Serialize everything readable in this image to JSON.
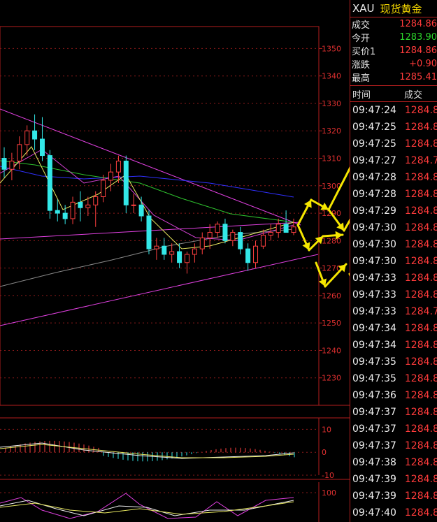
{
  "quote": {
    "symbol": "XAU",
    "name": "现货黄金",
    "rows": [
      {
        "label": "成交",
        "value": "1284.86",
        "color": "#ff3b3b"
      },
      {
        "label": "今开",
        "value": "1283.90",
        "color": "#2bd52b"
      },
      {
        "label": "买价1",
        "value": "1284.86",
        "color": "#ff3b3b"
      },
      {
        "label": "涨跌",
        "value": "+0.90",
        "color": "#ff3b3b"
      },
      {
        "label": "最高",
        "value": "1285.41",
        "color": "#ff3b3b"
      }
    ]
  },
  "ticks": {
    "headers": [
      "时间",
      "成交"
    ],
    "rows": [
      {
        "time": "09:47:24",
        "price": "1284.8"
      },
      {
        "time": "09:47:25",
        "price": "1284.8"
      },
      {
        "time": "09:47:25",
        "price": "1284.8"
      },
      {
        "time": "09:47:27",
        "price": "1284.7"
      },
      {
        "time": "09:47:28",
        "price": "1284.8"
      },
      {
        "time": "09:47:28",
        "price": "1284.8"
      },
      {
        "time": "09:47:29",
        "price": "1284.8"
      },
      {
        "time": "09:47:30",
        "price": "1284.8"
      },
      {
        "time": "09:47:30",
        "price": "1284.8"
      },
      {
        "time": "09:47:30",
        "price": "1284.8"
      },
      {
        "time": "09:47:33",
        "price": "1284.8"
      },
      {
        "time": "09:47:33",
        "price": "1284.8"
      },
      {
        "time": "09:47:33",
        "price": "1284.7"
      },
      {
        "time": "09:47:34",
        "price": "1284.8"
      },
      {
        "time": "09:47:34",
        "price": "1284.8"
      },
      {
        "time": "09:47:35",
        "price": "1284.8"
      },
      {
        "time": "09:47:35",
        "price": "1284.8"
      },
      {
        "time": "09:47:36",
        "price": "1284.8"
      },
      {
        "time": "09:47:37",
        "price": "1284.8"
      },
      {
        "time": "09:47:37",
        "price": "1284.8"
      },
      {
        "time": "09:47:37",
        "price": "1284.8"
      },
      {
        "time": "09:47:38",
        "price": "1284.8"
      },
      {
        "time": "09:47:39",
        "price": "1284.8"
      },
      {
        "time": "09:47:39",
        "price": "1284.8"
      },
      {
        "time": "09:47:40",
        "price": "1284.8"
      }
    ]
  },
  "chart_data": [
    {
      "type": "candlestick",
      "ylim": [
        1220,
        1358
      ],
      "yticks": [
        1230,
        1240,
        1250,
        1260,
        1270,
        1280,
        1290,
        1300,
        1310,
        1320,
        1330,
        1340,
        1350
      ],
      "ytick_labels": [
        "1230",
        "1240",
        "1250",
        "1260",
        "1270",
        "1280",
        "1290",
        "1300",
        "1310",
        "1320",
        "1330",
        "1340",
        "1350"
      ],
      "grid": true,
      "colors": {
        "up": "#ff4040",
        "down": "#33e8e8",
        "grid": "#8b1a1a",
        "axis": "#b41e1e",
        "tick_label": "#e03030"
      },
      "candles": [
        {
          "o": 1310,
          "h": 1314,
          "l": 1303,
          "c": 1306
        },
        {
          "o": 1306,
          "h": 1312,
          "l": 1302,
          "c": 1309
        },
        {
          "o": 1309,
          "h": 1318,
          "l": 1306,
          "c": 1315
        },
        {
          "o": 1315,
          "h": 1322,
          "l": 1311,
          "c": 1320
        },
        {
          "o": 1320,
          "h": 1326,
          "l": 1313,
          "c": 1317
        },
        {
          "o": 1317,
          "h": 1325,
          "l": 1309,
          "c": 1311
        },
        {
          "o": 1311,
          "h": 1313,
          "l": 1288,
          "c": 1291
        },
        {
          "o": 1291,
          "h": 1295,
          "l": 1287,
          "c": 1290
        },
        {
          "o": 1290,
          "h": 1293,
          "l": 1286,
          "c": 1288
        },
        {
          "o": 1288,
          "h": 1296,
          "l": 1286,
          "c": 1294
        },
        {
          "o": 1294,
          "h": 1298,
          "l": 1287,
          "c": 1292
        },
        {
          "o": 1292,
          "h": 1296,
          "l": 1289,
          "c": 1293
        },
        {
          "o": 1293,
          "h": 1298,
          "l": 1285,
          "c": 1296
        },
        {
          "o": 1296,
          "h": 1304,
          "l": 1294,
          "c": 1302
        },
        {
          "o": 1302,
          "h": 1308,
          "l": 1298,
          "c": 1305
        },
        {
          "o": 1305,
          "h": 1311,
          "l": 1301,
          "c": 1309
        },
        {
          "o": 1309,
          "h": 1311,
          "l": 1290,
          "c": 1293
        },
        {
          "o": 1293,
          "h": 1297,
          "l": 1290,
          "c": 1293
        },
        {
          "o": 1293,
          "h": 1296,
          "l": 1287,
          "c": 1289
        },
        {
          "o": 1289,
          "h": 1291,
          "l": 1275,
          "c": 1277
        },
        {
          "o": 1277,
          "h": 1281,
          "l": 1273,
          "c": 1278
        },
        {
          "o": 1278,
          "h": 1281,
          "l": 1273,
          "c": 1275
        },
        {
          "o": 1275,
          "h": 1279,
          "l": 1272,
          "c": 1276
        },
        {
          "o": 1276,
          "h": 1279,
          "l": 1270,
          "c": 1272
        },
        {
          "o": 1272,
          "h": 1276,
          "l": 1268,
          "c": 1275
        },
        {
          "o": 1275,
          "h": 1279,
          "l": 1272,
          "c": 1277
        },
        {
          "o": 1277,
          "h": 1283,
          "l": 1275,
          "c": 1281
        },
        {
          "o": 1281,
          "h": 1286,
          "l": 1277,
          "c": 1283
        },
        {
          "o": 1283,
          "h": 1287,
          "l": 1281,
          "c": 1286
        },
        {
          "o": 1286,
          "h": 1288,
          "l": 1279,
          "c": 1280
        },
        {
          "o": 1280,
          "h": 1284,
          "l": 1278,
          "c": 1283
        },
        {
          "o": 1283,
          "h": 1285,
          "l": 1275,
          "c": 1277
        },
        {
          "o": 1277,
          "h": 1279,
          "l": 1269,
          "c": 1272
        },
        {
          "o": 1272,
          "h": 1280,
          "l": 1270,
          "c": 1278
        },
        {
          "o": 1278,
          "h": 1284,
          "l": 1277,
          "c": 1282
        },
        {
          "o": 1282,
          "h": 1286,
          "l": 1280,
          "c": 1283
        },
        {
          "o": 1283,
          "h": 1288,
          "l": 1281,
          "c": 1286
        },
        {
          "o": 1286,
          "h": 1291,
          "l": 1284,
          "c": 1283
        },
        {
          "o": 1283,
          "h": 1288,
          "l": 1282,
          "c": 1285
        }
      ]
    },
    {
      "type": "bar",
      "ylim": [
        -10,
        15
      ],
      "yticks": [
        -10,
        0,
        10
      ],
      "ytick_labels": [
        "-10",
        "0",
        "10"
      ]
    },
    {
      "type": "line",
      "ylim": [
        0,
        110
      ],
      "yticks": [
        100
      ],
      "ytick_labels": [
        "100"
      ]
    }
  ]
}
